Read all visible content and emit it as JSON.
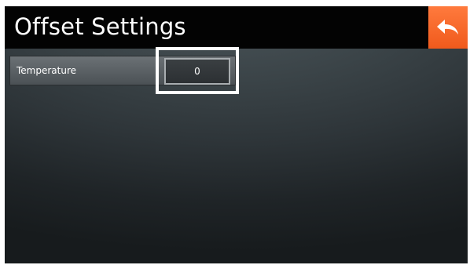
{
  "header": {
    "title": "Offset Settings",
    "back_icon": "back-arrow-icon",
    "accent_color": "#f26522"
  },
  "settings": {
    "rows": [
      {
        "label": "Temperature",
        "value": "0"
      }
    ]
  }
}
